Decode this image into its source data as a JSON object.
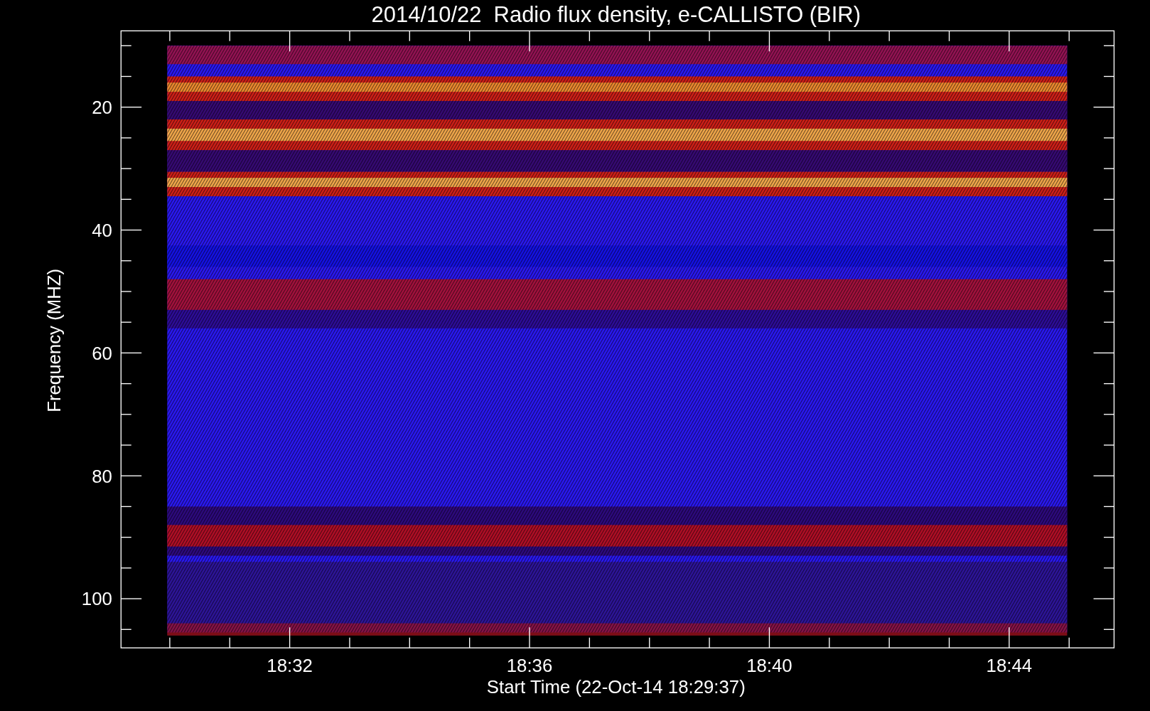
{
  "title": "2014/10/22  Radio flux density, e-CALLISTO (BIR)",
  "y_axis": {
    "label": "Frequency (MHZ)",
    "ticks": [
      "20",
      "40",
      "60",
      "80",
      "100"
    ]
  },
  "x_axis": {
    "label": "Start Time (22-Oct-14 18:29:37)",
    "ticks": [
      "18:32",
      "18:36",
      "18:40",
      "18:44"
    ]
  }
}
